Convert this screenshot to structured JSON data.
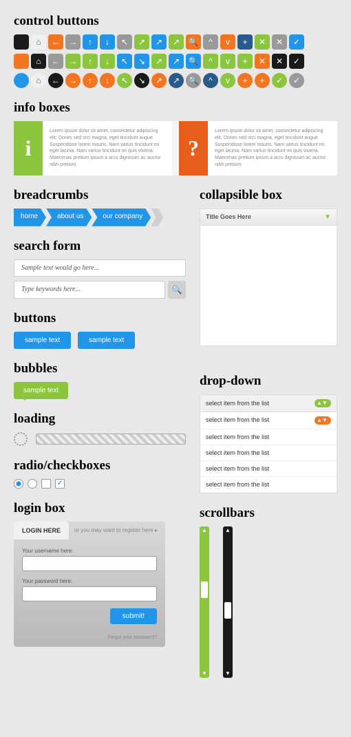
{
  "headings": {
    "control": "control buttons",
    "info": "info boxes",
    "breadcrumbs": "breadcrumbs",
    "collapsible": "collapsible box",
    "search": "search form",
    "buttons": "buttons",
    "bubbles": "bubbles",
    "loading": "loading",
    "dropdown": "drop-down",
    "radio": "radio/checkboxes",
    "scrollbars": "scrollbars",
    "login": "login box"
  },
  "info_text": "Lorem ipsum dolor sit amet, consectetur adipiscing elit. Donec sed orci magna, eget tincidunt augue. Suspendisse lorem mauris. Nam varius tincidunt mi eget lacinia. Nam varius tincidunt mi quis viverra. Maecenas pretium ipsum a arcu dignissim ac auctor nibh pretium.",
  "breadcrumb": {
    "items": [
      "home",
      "about us",
      "our company"
    ]
  },
  "search": {
    "placeholder1": "Sample text would go here...",
    "placeholder2": "Type keywords here..."
  },
  "buttons": {
    "label": "sample text"
  },
  "bubble": {
    "label": "sample text"
  },
  "collapsible": {
    "title": "Title Goes Here"
  },
  "dropdown": {
    "selected": "select item from the list",
    "items": [
      "select item from the list",
      "select item from the list",
      "select item from the list",
      "select item from the list",
      "select item from the list"
    ]
  },
  "login": {
    "tab": "LOGIN HERE",
    "register": "or you may want to register here",
    "username_label": "Your username here:",
    "password_label": "Your password here:",
    "submit": "submit!",
    "forgot": "Forgot your password?"
  },
  "icon_rows": [
    [
      {
        "c": "black",
        "g": ""
      },
      {
        "c": "white",
        "g": "⌂"
      },
      {
        "c": "orange",
        "g": "←"
      },
      {
        "c": "gray",
        "g": "→"
      },
      {
        "c": "blue",
        "g": "↑"
      },
      {
        "c": "blue",
        "g": "↓"
      },
      {
        "c": "gray",
        "g": "↖"
      },
      {
        "c": "green",
        "g": "↗"
      },
      {
        "c": "blue",
        "g": "↗"
      },
      {
        "c": "green",
        "g": "↗"
      },
      {
        "c": "orange",
        "g": "🔍"
      },
      {
        "c": "gray",
        "g": "^"
      },
      {
        "c": "orange",
        "g": "v"
      },
      {
        "c": "navy",
        "g": "+"
      },
      {
        "c": "green",
        "g": "✕"
      },
      {
        "c": "gray",
        "g": "✕"
      },
      {
        "c": "blue",
        "g": "✓"
      }
    ],
    [
      {
        "c": "orange",
        "g": ""
      },
      {
        "c": "black",
        "g": "⌂"
      },
      {
        "c": "gray",
        "g": "←"
      },
      {
        "c": "green",
        "g": "→"
      },
      {
        "c": "green",
        "g": "↑"
      },
      {
        "c": "green",
        "g": "↓"
      },
      {
        "c": "blue",
        "g": "↖"
      },
      {
        "c": "blue",
        "g": "↘"
      },
      {
        "c": "green",
        "g": "↗"
      },
      {
        "c": "blue",
        "g": "↗"
      },
      {
        "c": "blue",
        "g": "🔍"
      },
      {
        "c": "green",
        "g": "^"
      },
      {
        "c": "green",
        "g": "v"
      },
      {
        "c": "green",
        "g": "+"
      },
      {
        "c": "orange",
        "g": "✕"
      },
      {
        "c": "black",
        "g": "✕"
      },
      {
        "c": "black",
        "g": "✓"
      }
    ],
    [
      {
        "c": "blue",
        "g": ""
      },
      {
        "c": "white",
        "g": "⌂"
      },
      {
        "c": "black",
        "g": "←"
      },
      {
        "c": "orange",
        "g": "→"
      },
      {
        "c": "orange",
        "g": "↑"
      },
      {
        "c": "orange",
        "g": "↓"
      },
      {
        "c": "green",
        "g": "↖"
      },
      {
        "c": "black",
        "g": "↘"
      },
      {
        "c": "orange",
        "g": "↗"
      },
      {
        "c": "navy",
        "g": "↗"
      },
      {
        "c": "gray",
        "g": "🔍"
      },
      {
        "c": "navy",
        "g": "^"
      },
      {
        "c": "green",
        "g": "v"
      },
      {
        "c": "orange",
        "g": "+"
      },
      {
        "c": "orange",
        "g": "+"
      },
      {
        "c": "green",
        "g": "✓"
      },
      {
        "c": "gray",
        "g": "✓"
      }
    ]
  ]
}
